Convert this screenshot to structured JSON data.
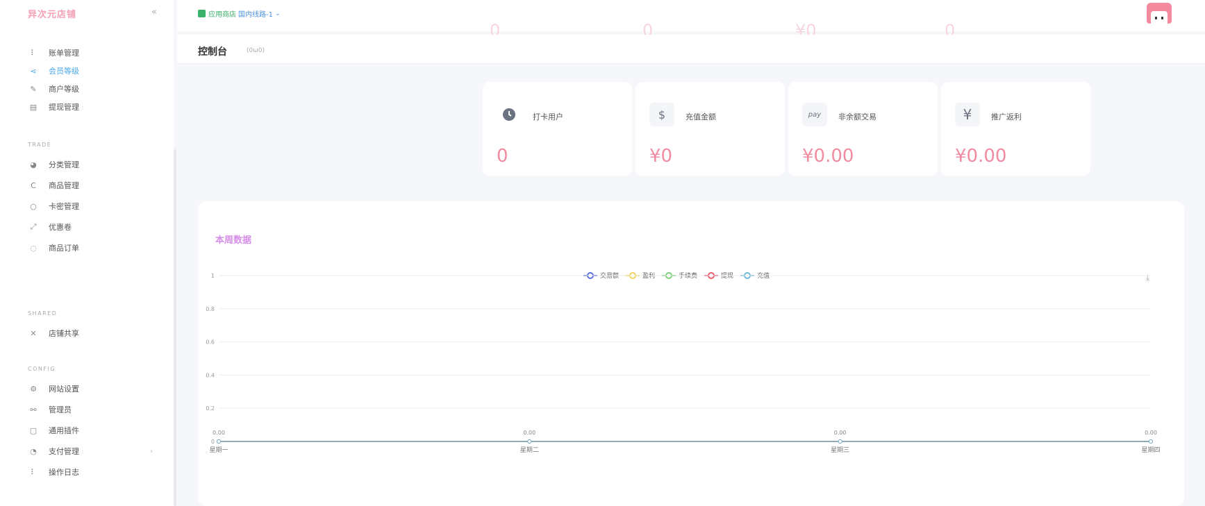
{
  "sidebar": {
    "brand": "异次元店铺",
    "collapse_icon": "«",
    "items_top": [
      {
        "label": "账单管理",
        "icon": "bill-icon",
        "glyph": "⠇",
        "active": false
      },
      {
        "label": "会员等级",
        "icon": "share-icon",
        "glyph": "⋖",
        "active": true
      },
      {
        "label": "商户等级",
        "icon": "merchant-icon",
        "glyph": "✎",
        "active": false
      },
      {
        "label": "提现管理",
        "icon": "withdraw-icon",
        "glyph": "▤",
        "active": false
      }
    ],
    "section_trade": "TRADE",
    "items_trade": [
      {
        "label": "分类管理",
        "icon": "category-icon",
        "glyph": "◕"
      },
      {
        "label": "商品管理",
        "icon": "goods-icon",
        "glyph": "C"
      },
      {
        "label": "卡密管理",
        "icon": "card-icon",
        "glyph": "○"
      },
      {
        "label": "优惠卷",
        "icon": "coupon-icon",
        "glyph": "⤢"
      },
      {
        "label": "商品订单",
        "icon": "order-icon",
        "glyph": "◌"
      }
    ],
    "section_shared": "SHARED",
    "items_shared": [
      {
        "label": "店铺共享",
        "icon": "shared-icon",
        "glyph": "✕"
      }
    ],
    "section_config": "CONFIG",
    "items_config": [
      {
        "label": "网站设置",
        "icon": "settings-icon",
        "glyph": "⚙"
      },
      {
        "label": "管理员",
        "icon": "admin-icon",
        "glyph": "⚯"
      },
      {
        "label": "通用插件",
        "icon": "plugin-icon",
        "glyph": "▢"
      },
      {
        "label": "支付管理",
        "icon": "payment-icon",
        "glyph": "◔",
        "has_arrow": true
      },
      {
        "label": "操作日志",
        "icon": "log-icon",
        "glyph": "⠇"
      }
    ],
    "arrow_glyph": "›"
  },
  "topbar": {
    "store_name": "应用商店",
    "store_line": "国内线路-1",
    "chevron": "⌄",
    "ghost_values": [
      "0",
      "0",
      "¥0",
      "0"
    ]
  },
  "page": {
    "title": "控制台",
    "subtitle": "(0ω0)"
  },
  "stats": [
    {
      "label": "打卡用户",
      "value": "0",
      "icon": "clock-icon",
      "glyph": "🕓"
    },
    {
      "label": "充值金额",
      "value": "¥0",
      "icon": "recharge-icon",
      "glyph": "$"
    },
    {
      "label": "非余额交易",
      "value": "¥0.00",
      "icon": "pay-icon",
      "glyph": "pay"
    },
    {
      "label": "推广返利",
      "value": "¥0.00",
      "icon": "yen-icon",
      "glyph": "¥"
    }
  ],
  "chart_panel": {
    "title": "本周数据",
    "download_glyph": "⤓"
  },
  "chart_data": {
    "type": "line",
    "title": "本周数据",
    "xlabel": "",
    "ylabel": "",
    "categories": [
      "星期一",
      "星期二",
      "星期三",
      "星期四"
    ],
    "ylim": [
      0,
      1
    ],
    "yticks": [
      "0",
      "0.2",
      "0.4",
      "0.6",
      "0.8",
      "1"
    ],
    "grid": true,
    "legend_position": "top-center",
    "series": [
      {
        "name": "交易额",
        "color": "#5b6ee1",
        "values": [
          0,
          0,
          0,
          0
        ]
      },
      {
        "name": "盈利",
        "color": "#f2d45c",
        "values": [
          0,
          0,
          0,
          0
        ]
      },
      {
        "name": "手续费",
        "color": "#7ccf7c",
        "values": [
          0,
          0,
          0,
          0
        ]
      },
      {
        "name": "提现",
        "color": "#e8596f",
        "values": [
          0,
          0,
          0,
          0
        ]
      },
      {
        "name": "充值",
        "color": "#6fb8d8",
        "values": [
          0,
          0,
          0,
          0
        ]
      }
    ],
    "data_labels": [
      "0.00",
      "0.00",
      "0.00",
      "0.00"
    ]
  }
}
